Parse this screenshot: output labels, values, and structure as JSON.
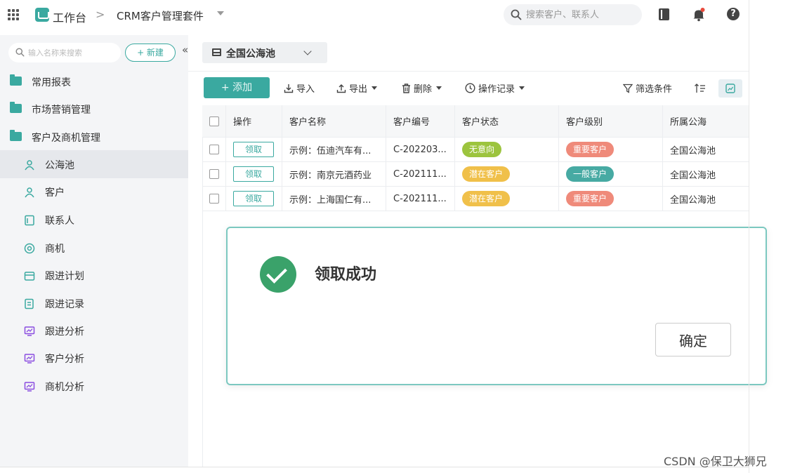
{
  "topbar": {
    "workbench": "工作台",
    "separator": ">",
    "suite_name": "CRM客户管理套件",
    "search_placeholder": "搜索客户、联系人",
    "help": "?"
  },
  "sidebar": {
    "search_placeholder": "输入名称来搜索",
    "new_button": "+ 新建",
    "collapse": "«",
    "groups": [
      {
        "label": "常用报表",
        "icon": "folder-icon"
      },
      {
        "label": "市场营销管理",
        "icon": "folder-icon"
      },
      {
        "label": "客户及商机管理",
        "icon": "folder-open-icon"
      }
    ],
    "items": [
      {
        "label": "公海池",
        "icon": "user-pool-icon",
        "active": true
      },
      {
        "label": "客户",
        "icon": "user-icon"
      },
      {
        "label": "联系人",
        "icon": "contact-card-icon"
      },
      {
        "label": "商机",
        "icon": "opportunity-icon"
      },
      {
        "label": "跟进计划",
        "icon": "calendar-icon"
      },
      {
        "label": "跟进记录",
        "icon": "record-icon"
      },
      {
        "label": "跟进分析",
        "icon": "monitor-chart-icon"
      },
      {
        "label": "客户分析",
        "icon": "monitor-chart-icon"
      },
      {
        "label": "商机分析",
        "icon": "monitor-chart-icon"
      }
    ]
  },
  "main": {
    "view_tab": "全国公海池",
    "toolbar": {
      "add": "+ 添加",
      "import": "导入",
      "export": "导出",
      "delete": "删除",
      "history": "操作记录",
      "filter": "筛选条件"
    },
    "table": {
      "headers": [
        "操作",
        "客户名称",
        "客户编号",
        "客户状态",
        "客户级别",
        "所属公海"
      ],
      "rows": [
        {
          "action": "领取",
          "name": "示例：伍迪汽车有...",
          "code": "C-202203...",
          "status": "无意向",
          "status_color": "#9cc43e",
          "level": "重要客户",
          "level_color": "#ef8a7a",
          "pool": "全国公海池"
        },
        {
          "action": "领取",
          "name": "示例：南京元酒药业",
          "code": "C-202111...",
          "status": "潜在客户",
          "status_color": "#f0c04a",
          "level": "一般客户",
          "level_color": "#47aaa3",
          "pool": "全国公海池"
        },
        {
          "action": "领取",
          "name": "示例：上海国仁有...",
          "code": "C-202111...",
          "status": "潜在客户",
          "status_color": "#f0c04a",
          "level": "重要客户",
          "level_color": "#ef8a7a",
          "pool": "全国公海池"
        }
      ]
    }
  },
  "dialog": {
    "title": "领取成功",
    "confirm": "确定"
  },
  "watermark": "CSDN @保卫大狮兄",
  "colors": {
    "accent": "#3aa9a0",
    "success": "#3aa26a"
  }
}
